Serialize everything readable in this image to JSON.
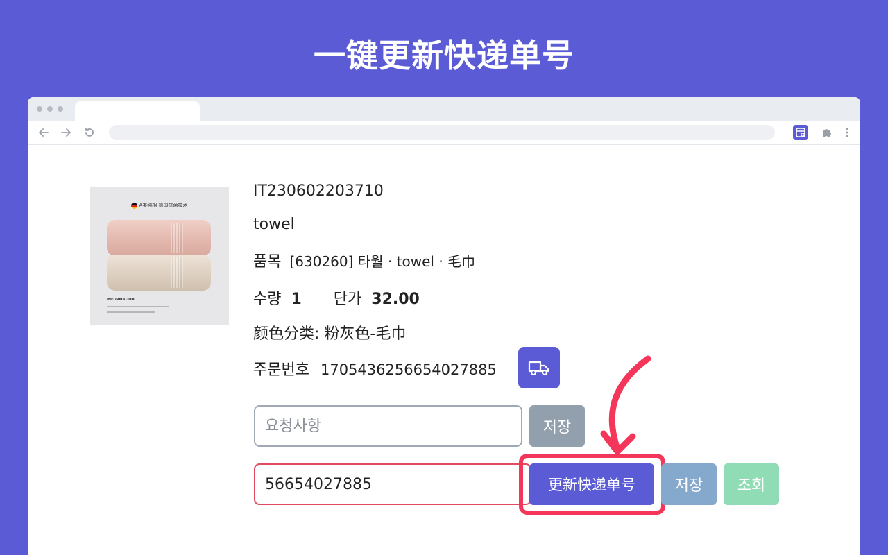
{
  "banner": {
    "title": "一键更新快递单号"
  },
  "colors": {
    "brand": "#5a5bd5",
    "highlight": "#f4365a",
    "save_gray": "#929fad",
    "save_blue": "#85a8cd",
    "lookup_green": "#8fdcb5"
  },
  "icons": [
    "back-arrow-icon",
    "forward-arrow-icon",
    "reload-icon",
    "extension-icon",
    "puzzle-icon",
    "kebab-menu-icon",
    "truck-icon",
    "pointer-arrow-icon"
  ],
  "product": {
    "image_text": {
      "header": "A类纯棉 德国抗菌技术",
      "info": "INFORMATION"
    },
    "order_id": "IT230602203710",
    "name": "towel",
    "category_label": "품목",
    "category_value": "[630260] 타월 · towel · 毛巾",
    "quantity_label": "수량",
    "quantity_value": "1",
    "price_label": "단가",
    "price_value": "32.00",
    "color_option": "颜色分类: 粉灰色-毛巾",
    "order_number_label": "주문번호",
    "order_number_value": "1705436256654027885"
  },
  "memo": {
    "placeholder": "요청사항",
    "value": "",
    "save_label": "저장"
  },
  "tracking": {
    "value": "56654027885",
    "update_label": "更新快递单号",
    "save_label": "저장",
    "lookup_label": "조회"
  }
}
